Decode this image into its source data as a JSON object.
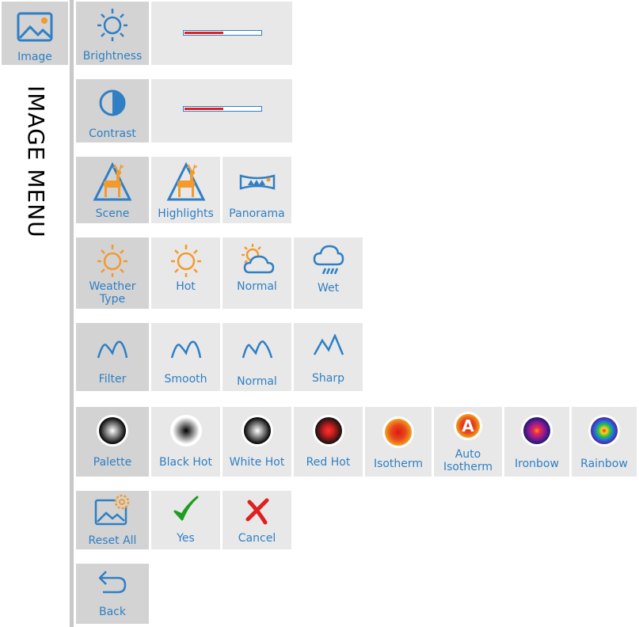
{
  "sidebar": {
    "image_label": "Image",
    "title": "IMAGE MENU"
  },
  "rows": {
    "brightness": {
      "label": "Brightness",
      "level": 0.5
    },
    "contrast": {
      "label": "Contrast",
      "level": 0.5
    },
    "scene": {
      "label": "Scene",
      "options": [
        "Highlights",
        "Panorama"
      ]
    },
    "weather": {
      "label": "Weather\nType",
      "options": [
        "Hot",
        "Normal",
        "Wet"
      ]
    },
    "filter": {
      "label": "Filter",
      "options": [
        "Smooth",
        "Normal",
        "Sharp"
      ]
    },
    "palette": {
      "label": "Palette",
      "options": [
        "Black Hot",
        "White Hot",
        "Red Hot",
        "Isotherm",
        "Auto\nIsotherm",
        "Ironbow",
        "Rainbow"
      ],
      "auto_badge": "A"
    },
    "reset": {
      "label": "Reset All",
      "yes": "Yes",
      "cancel": "Cancel"
    },
    "back": {
      "label": "Back"
    }
  },
  "colors": {
    "accent": "#2f7fc4",
    "orange": "#f39a2d",
    "red": "#e02020",
    "green": "#1e9e1e",
    "tile": "#e8e8e8",
    "tile_selected": "#d3d3d3"
  },
  "icons": {
    "image": "image-icon",
    "brightness": "sun-icon",
    "contrast": "half-circle-icon",
    "scene": "deer-icon",
    "panorama": "panorama-icon",
    "weather_hot": "sun-icon",
    "weather_normal": "sun-cloud-icon",
    "weather_wet": "rain-cloud-icon",
    "filter": "peaks-icon",
    "reset": "image-gear-icon",
    "yes": "checkmark-icon",
    "cancel": "x-mark-icon",
    "back": "back-arrow-icon"
  }
}
